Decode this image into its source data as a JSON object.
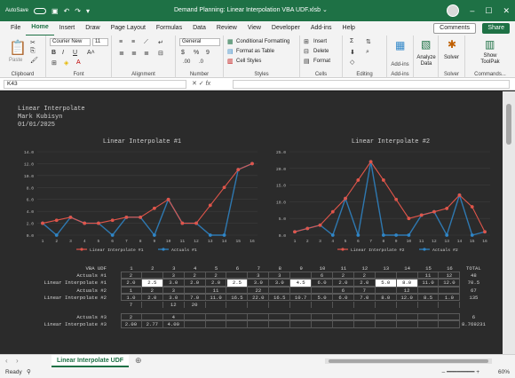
{
  "titlebar": {
    "autosave": "AutoSave",
    "doc_title": "Demand Planning: Linear Interpolation VBA UDF.xlsb",
    "qat_icons": [
      "autosave-toggle",
      "save-icon",
      "undo-icon",
      "redo-icon"
    ],
    "caret": "⌄"
  },
  "menu": {
    "tabs": [
      "File",
      "Home",
      "Insert",
      "Draw",
      "Page Layout",
      "Formulas",
      "Data",
      "Review",
      "View",
      "Developer",
      "Add-ins",
      "Help"
    ],
    "active": "Home",
    "comments": "Comments",
    "share": "Share"
  },
  "ribbon": {
    "clipboard": "Clipboard",
    "paste": "Paste",
    "font_name": "Courier New",
    "font_size": "11",
    "font": "Font",
    "alignment": "Alignment",
    "number_format": "General",
    "number": "Number",
    "conditional": "Conditional Formatting",
    "format_table": "Format as Table",
    "cell_styles": "Cell Styles",
    "styles": "Styles",
    "insert": "Insert",
    "delete": "Delete",
    "format": "Format",
    "cells": "Cells",
    "editing": "Editing",
    "addins": "Add-ins",
    "analyze": "Analyze Data",
    "solver": "Solver",
    "show_toolpak": "Show ToolPak",
    "commands": "Commands..."
  },
  "formula_bar": {
    "name_box": "K43",
    "fx": "fx"
  },
  "sheet": {
    "header": [
      "Linear Interpolate",
      "Mark Kubisyn",
      "01/01/2025"
    ],
    "chart1_title": "Linear Interpolate #1",
    "chart2_title": "Linear Interpolate #2",
    "legend1": [
      "Linear Interpolate #1",
      "Actuals #1"
    ],
    "legend2": [
      "Linear Interpolate #2",
      "Actuals #2"
    ]
  },
  "chart_data": [
    {
      "type": "line",
      "title": "Linear Interpolate #1",
      "x": [
        "1",
        "2",
        "3",
        "4",
        "5",
        "6",
        "7",
        "8",
        "9",
        "10",
        "11",
        "12",
        "13",
        "14",
        "15",
        "16"
      ],
      "ylim": [
        0,
        14
      ],
      "yticks": [
        "0.0",
        "2.0",
        "4.0",
        "6.0",
        "8.0",
        "10.0",
        "12.0",
        "14.0"
      ],
      "series": [
        {
          "name": "Linear Interpolate #1",
          "color": "#e0554a",
          "values": [
            2.0,
            2.5,
            3.0,
            2.0,
            2.0,
            2.5,
            3.0,
            3.0,
            4.5,
            6.0,
            2.0,
            2.0,
            5.0,
            8.0,
            11.0,
            12.0
          ]
        },
        {
          "name": "Actuals #1",
          "color": "#2f86c8",
          "values": [
            2,
            0,
            3,
            2,
            2,
            0,
            3,
            3,
            0,
            6,
            2,
            2,
            0,
            0,
            11,
            12
          ]
        }
      ]
    },
    {
      "type": "line",
      "title": "Linear Interpolate #2",
      "x": [
        "1",
        "2",
        "3",
        "4",
        "5",
        "6",
        "7",
        "8",
        "9",
        "10",
        "11",
        "12",
        "13",
        "14",
        "15",
        "16"
      ],
      "ylim": [
        0,
        25
      ],
      "yticks": [
        "0.0",
        "5.0",
        "10.0",
        "15.0",
        "20.0",
        "25.0"
      ],
      "series": [
        {
          "name": "Linear Interpolate #2",
          "color": "#e0554a",
          "values": [
            1.0,
            2.0,
            3.0,
            7.0,
            11.0,
            16.5,
            22.0,
            16.5,
            10.7,
            5.0,
            6.0,
            7.0,
            8.0,
            12.0,
            8.5,
            1.0
          ]
        },
        {
          "name": "Actuals #2",
          "color": "#2f86c8",
          "values": [
            1,
            2,
            3,
            0,
            11,
            0,
            22,
            0,
            0,
            0,
            6,
            7,
            0,
            12,
            0,
            1
          ]
        }
      ]
    }
  ],
  "table": {
    "cols": [
      "VBA UDF",
      "1",
      "2",
      "3",
      "4",
      "5",
      "6",
      "7",
      "8",
      "9",
      "10",
      "11",
      "12",
      "13",
      "14",
      "15",
      "16",
      "TOTAL"
    ],
    "rows": [
      {
        "label": "Actuals #1",
        "cells": [
          "2",
          "",
          "3",
          "2",
          "2",
          "",
          "3",
          "3",
          "",
          "6",
          "2",
          "2",
          "",
          "",
          "11",
          "12"
        ],
        "total": "48"
      },
      {
        "label": "Linear Interpolate #1",
        "cells": [
          "2.0",
          "2.5",
          "3.0",
          "2.0",
          "2.0",
          "2.5",
          "3.0",
          "3.0",
          "4.5",
          "6.0",
          "2.0",
          "2.0",
          "5.0",
          "8.0",
          "11.0",
          "12.0"
        ],
        "total": "70.5"
      },
      {
        "label": "Actuals #2",
        "cells": [
          "1",
          "2",
          "3",
          "",
          "11",
          "",
          "22",
          "",
          "",
          "",
          "6",
          "7",
          "",
          "12",
          "",
          ""
        ],
        "total": "67"
      },
      {
        "label": "Linear Interpolate #2",
        "cells": [
          "1.0",
          "2.0",
          "3.0",
          "7.0",
          "11.0",
          "16.5",
          "22.0",
          "16.5",
          "10.7",
          "5.0",
          "6.0",
          "7.0",
          "8.0",
          "12.0",
          "8.5",
          "1.0"
        ],
        "total": "135"
      },
      {
        "label": "",
        "cells": [
          "7",
          "",
          "12",
          "20",
          "",
          "",
          "",
          "",
          "",
          "",
          "",
          "",
          "",
          "",
          "",
          ""
        ],
        "total": ""
      },
      {
        "label": "Actuals #3",
        "cells": [
          "2",
          "",
          "4",
          "",
          "",
          "",
          "",
          "",
          "",
          "",
          "",
          "",
          "",
          "",
          "",
          ""
        ],
        "total": "6"
      },
      {
        "label": "Linear Interpolate #3",
        "cells": [
          "2.00",
          "2.77",
          "4.00",
          "",
          "",
          "",
          "",
          "",
          "",
          "",
          "",
          "",
          "",
          "",
          "",
          ""
        ],
        "total": "8.769231"
      }
    ]
  },
  "sheet_tab": "Linear Interpolate UDF",
  "status": {
    "ready": "Ready",
    "zoom": "60%"
  }
}
